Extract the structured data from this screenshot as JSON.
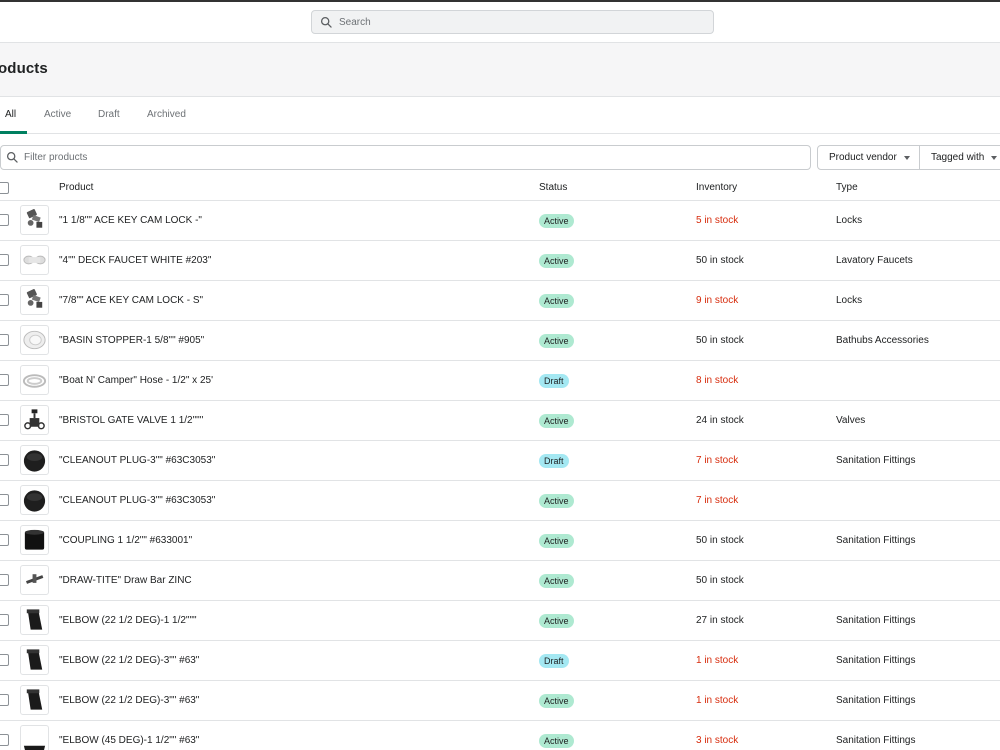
{
  "topbar": {
    "search_placeholder": "Search"
  },
  "page": {
    "title": "Products"
  },
  "tabs": [
    {
      "label": "All",
      "active": true
    },
    {
      "label": "Active",
      "active": false
    },
    {
      "label": "Draft",
      "active": false
    },
    {
      "label": "Archived",
      "active": false
    }
  ],
  "filters": {
    "filter_placeholder": "Filter products",
    "vendor_label": "Product vendor",
    "tagged_label": "Tagged with"
  },
  "table": {
    "headers": {
      "product": "Product",
      "status": "Status",
      "inventory": "Inventory",
      "type": "Type"
    },
    "rows": [
      {
        "name": "\"1 1/8\"\" ACE KEY CAM LOCK -\"",
        "status": "Active",
        "inventory": "5 in stock",
        "low": true,
        "type": "Locks",
        "thumb": "lock"
      },
      {
        "name": "\"4\"\" DECK FAUCET WHITE #203\"",
        "status": "Active",
        "inventory": "50 in stock",
        "low": false,
        "type": "Lavatory Faucets",
        "thumb": "faucet"
      },
      {
        "name": "\"7/8\"\" ACE KEY CAM LOCK - S\"",
        "status": "Active",
        "inventory": "9 in stock",
        "low": true,
        "type": "Locks",
        "thumb": "lock"
      },
      {
        "name": "\"BASIN STOPPER-1 5/8\"\" #905\"",
        "status": "Active",
        "inventory": "50 in stock",
        "low": false,
        "type": "Bathubs Accessories",
        "thumb": "stopper"
      },
      {
        "name": "\"Boat N' Camper\" Hose - 1/2\" x 25'",
        "status": "Draft",
        "inventory": "8 in stock",
        "low": true,
        "type": "",
        "thumb": "hose"
      },
      {
        "name": "\"BRISTOL GATE VALVE 1 1/2\"\"\"",
        "status": "Active",
        "inventory": "24 in stock",
        "low": false,
        "type": "Valves",
        "thumb": "valve"
      },
      {
        "name": "\"CLEANOUT PLUG-3\"\" #63C3053\"",
        "status": "Draft",
        "inventory": "7 in stock",
        "low": true,
        "type": "Sanitation Fittings",
        "thumb": "plug"
      },
      {
        "name": "\"CLEANOUT PLUG-3\"\" #63C3053\"",
        "status": "Active",
        "inventory": "7 in stock",
        "low": true,
        "type": "",
        "thumb": "plug"
      },
      {
        "name": "\"COUPLING 1 1/2\"\" #633001\"",
        "status": "Active",
        "inventory": "50 in stock",
        "low": false,
        "type": "Sanitation Fittings",
        "thumb": "coupling"
      },
      {
        "name": "\"DRAW-TITE\" Draw Bar ZINC",
        "status": "Active",
        "inventory": "50 in stock",
        "low": false,
        "type": "",
        "thumb": "drawbar"
      },
      {
        "name": "\"ELBOW (22 1/2 DEG)-1 1/2\"\"\"",
        "status": "Active",
        "inventory": "27 in stock",
        "low": false,
        "type": "Sanitation Fittings",
        "thumb": "elbow"
      },
      {
        "name": "\"ELBOW (22 1/2 DEG)-3\"\" #63\"",
        "status": "Draft",
        "inventory": "1 in stock",
        "low": true,
        "type": "Sanitation Fittings",
        "thumb": "elbow"
      },
      {
        "name": "\"ELBOW (22 1/2 DEG)-3\"\" #63\"",
        "status": "Active",
        "inventory": "1 in stock",
        "low": true,
        "type": "Sanitation Fittings",
        "thumb": "elbow"
      },
      {
        "name": "\"ELBOW (45 DEG)-1 1/2\"\" #63\"",
        "status": "Active",
        "inventory": "3 in stock",
        "low": true,
        "type": "Sanitation Fittings",
        "thumb": "elbow45"
      }
    ]
  },
  "colors": {
    "accent": "#008060",
    "active_badge": "#aee9d1",
    "draft_badge": "#a4e8f2",
    "low_stock": "#d72c0d"
  }
}
